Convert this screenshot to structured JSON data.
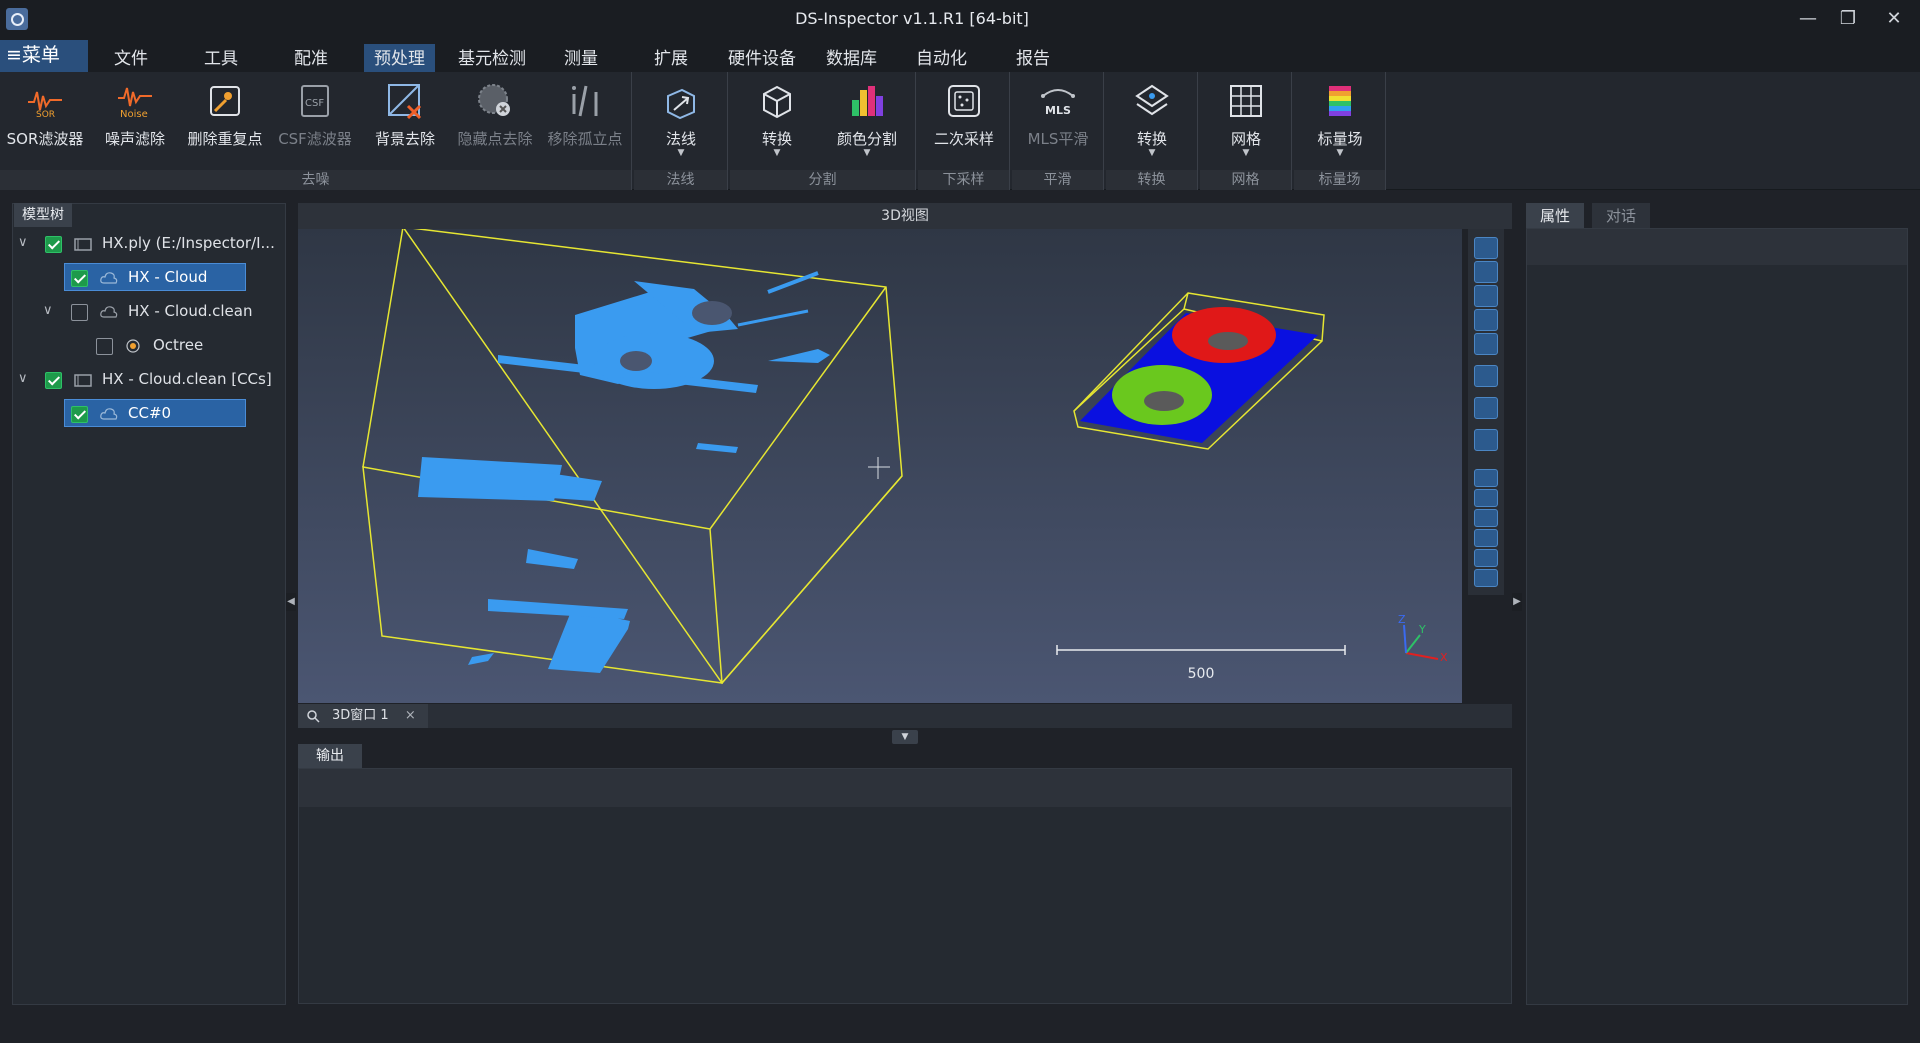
{
  "window": {
    "title": "DS-Inspector v1.1.R1 [64-bit]",
    "controls": {
      "minimize": "—",
      "restore": "❐",
      "close": "✕"
    }
  },
  "menubar": {
    "main": "≡菜单",
    "items": [
      "文件",
      "工具",
      "配准",
      "预处理",
      "基元检测",
      "测量",
      "扩展",
      "硬件设备",
      "数据库",
      "自动化",
      "报告"
    ],
    "active": "预处理"
  },
  "ribbon": {
    "groups": [
      {
        "label": "去噪",
        "tools": [
          {
            "label": "SOR滤波器",
            "icon": "sor-icon",
            "enabled": true
          },
          {
            "label": "噪声滤除",
            "icon": "noise-icon",
            "enabled": true
          },
          {
            "label": "删除重复点",
            "icon": "remove-duplicate-icon",
            "enabled": true
          },
          {
            "label": "CSF滤波器",
            "icon": "csf-icon",
            "enabled": false
          },
          {
            "label": "背景去除",
            "icon": "background-remove-icon",
            "enabled": true
          },
          {
            "label": "隐藏点去除",
            "icon": "hidden-point-icon",
            "enabled": false
          },
          {
            "label": "移除孤立点",
            "icon": "isolated-point-icon",
            "enabled": false
          }
        ]
      },
      {
        "label": "法线",
        "tools": [
          {
            "label": "法线",
            "icon": "normal-icon",
            "enabled": true,
            "dropdown": true
          }
        ]
      },
      {
        "label": "分割",
        "tools": [
          {
            "label": "转换",
            "icon": "convert-icon",
            "enabled": true,
            "dropdown": true
          },
          {
            "label": "颜色分割",
            "icon": "color-segment-icon",
            "enabled": true,
            "dropdown": true
          }
        ]
      },
      {
        "label": "下采样",
        "tools": [
          {
            "label": "二次采样",
            "icon": "subsample-icon",
            "enabled": true
          }
        ]
      },
      {
        "label": "平滑",
        "tools": [
          {
            "label": "MLS平滑",
            "icon": "mls-icon",
            "enabled": false
          }
        ]
      },
      {
        "label": "转换",
        "tools": [
          {
            "label": "转换",
            "icon": "layer-convert-icon",
            "enabled": true,
            "dropdown": true
          }
        ]
      },
      {
        "label": "网格",
        "tools": [
          {
            "label": "网格",
            "icon": "mesh-icon",
            "enabled": true,
            "dropdown": true
          }
        ]
      },
      {
        "label": "标量场",
        "tools": [
          {
            "label": "标量场",
            "icon": "scalar-field-icon",
            "enabled": true,
            "dropdown": true
          }
        ]
      }
    ]
  },
  "model_tree": {
    "tab": "模型树",
    "nodes": [
      {
        "label": "HX.ply (E:/Inspector/I...",
        "checked": true,
        "expanded": true,
        "selected": false,
        "icon": "folder-icon"
      },
      {
        "label": "HX - Cloud",
        "checked": true,
        "selected": true,
        "icon": "cloud-icon"
      },
      {
        "label": "HX - Cloud.clean",
        "checked": false,
        "expanded": true,
        "selected": false,
        "icon": "cloud-icon"
      },
      {
        "label": "Octree",
        "checked": false,
        "selected": false,
        "icon": "octree-icon"
      },
      {
        "label": "HX - Cloud.clean [CCs]",
        "checked": true,
        "expanded": true,
        "selected": false,
        "icon": "folder-icon"
      },
      {
        "label": "CC#0",
        "checked": true,
        "selected": true,
        "icon": "cloud-icon"
      }
    ]
  },
  "view": {
    "header": "3D视图",
    "scale_label": "500",
    "axes": {
      "x": "X",
      "y": "Y",
      "z": "Z"
    },
    "doc_tab": "3D窗口 1",
    "doc_tab_close": "×"
  },
  "output": {
    "tab": "输出"
  },
  "right_panel": {
    "tabs": [
      "属性",
      "对话"
    ],
    "active": "属性"
  },
  "colors": {
    "accent": "#2a4f7c",
    "cloud": "#3a9bf0",
    "bbox": "#e6e632",
    "selection": "#2a63a4"
  }
}
